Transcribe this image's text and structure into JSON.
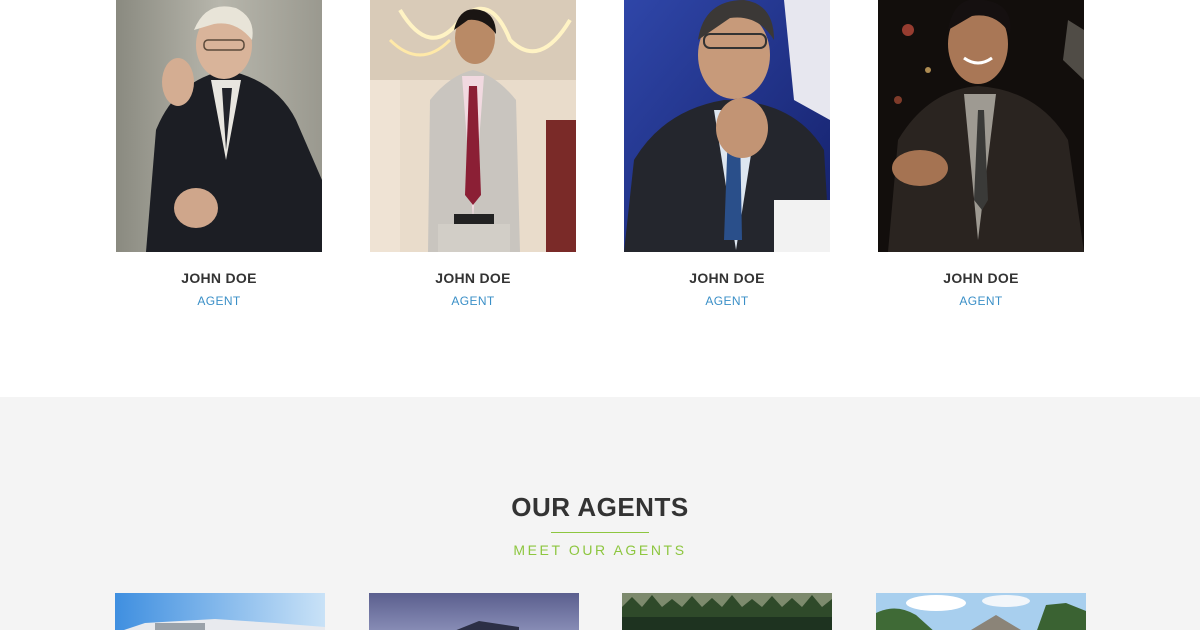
{
  "agents": [
    {
      "name": "JOHN DOE",
      "role": "AGENT"
    },
    {
      "name": "JOHN DOE",
      "role": "AGENT"
    },
    {
      "name": "JOHN DOE",
      "role": "AGENT"
    },
    {
      "name": "JOHN DOE",
      "role": "AGENT"
    }
  ],
  "section": {
    "title": "OUR AGENTS",
    "subtitle": "MEET OUR AGENTS"
  },
  "colors": {
    "accent_green": "#8dc63f",
    "link_blue": "#3a8fc7",
    "heading": "#333333",
    "section_bg": "#f4f4f4"
  }
}
